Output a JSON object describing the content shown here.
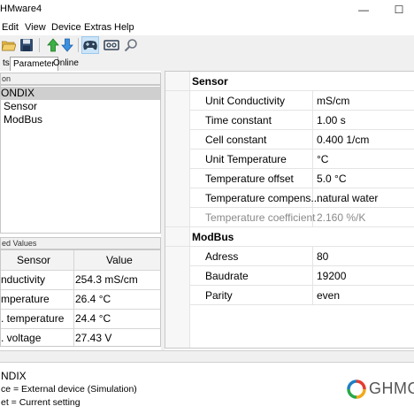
{
  "window": {
    "title": "HMware4",
    "controls": [
      "—",
      "☐"
    ]
  },
  "menu": [
    "Edit",
    "View",
    "Device",
    "Extras",
    "Help"
  ],
  "toolbar": {
    "icons": [
      "open-folder-icon",
      "save-icon",
      "upload-icon",
      "download-icon",
      "gamepad-icon",
      "cassette-icon",
      "search-icon"
    ]
  },
  "tabs": [
    {
      "label": "ts",
      "active": false
    },
    {
      "label": "Parameter",
      "active": true
    },
    {
      "label": "Online",
      "active": false
    }
  ],
  "tree": {
    "header": "on",
    "items": [
      {
        "label": "ONDIX",
        "selected": true
      },
      {
        "label": "Sensor",
        "selected": false
      },
      {
        "label": "ModBus",
        "selected": false
      }
    ]
  },
  "measured_values": {
    "header": "ed Values",
    "columns": [
      "Sensor",
      "Value"
    ],
    "rows": [
      {
        "sensor": "nductivity",
        "value": "254.3 mS/cm"
      },
      {
        "sensor": "mperature",
        "value": "26.4 °C"
      },
      {
        "sensor": ". temperature",
        "value": "24.4 °C"
      },
      {
        "sensor": ". voltage",
        "value": "27.43 V"
      }
    ]
  },
  "properties": {
    "categories": [
      {
        "name": "Sensor",
        "rows": [
          {
            "name": "Unit Conductivity",
            "value": "mS/cm",
            "disabled": false
          },
          {
            "name": "Time constant",
            "value": "1.00 s",
            "disabled": false
          },
          {
            "name": "Cell constant",
            "value": "0.400 1/cm",
            "disabled": false
          },
          {
            "name": "Unit Temperature",
            "value": "°C",
            "disabled": false
          },
          {
            "name": "Temperature offset",
            "value": "5.0 °C",
            "disabled": false
          },
          {
            "name": "Temperature compens...",
            "value": "natural water",
            "disabled": false
          },
          {
            "name": "Temperature coefficient",
            "value": "2.160 %/K",
            "disabled": true
          }
        ]
      },
      {
        "name": "ModBus",
        "rows": [
          {
            "name": "Adress",
            "value": "80",
            "disabled": false
          },
          {
            "name": "Baudrate",
            "value": "19200",
            "disabled": false
          },
          {
            "name": "Parity",
            "value": "even",
            "disabled": false
          }
        ]
      }
    ]
  },
  "info": {
    "device": "NDIX",
    "line1": "ce = External device (Simulation)",
    "line2": "et = Current setting"
  },
  "logo": {
    "text": "GHMGR",
    "colors": [
      "#e63a2e",
      "#f2a91b",
      "#2aa84a",
      "#1f7fc2"
    ]
  }
}
